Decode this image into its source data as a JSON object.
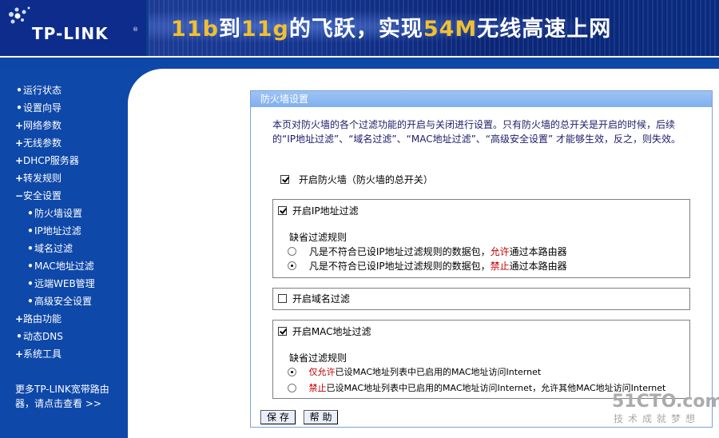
{
  "header": {
    "logo": "TP-LINK",
    "slogan_parts": [
      {
        "text": "11b",
        "hl": true
      },
      {
        "text": "到",
        "hl": false
      },
      {
        "text": "11g",
        "hl": true
      },
      {
        "text": "的飞跃，实现",
        "hl": false
      },
      {
        "text": "54M",
        "hl": true
      },
      {
        "text": "无线高速上网",
        "hl": false
      }
    ]
  },
  "sidebar": {
    "items": [
      {
        "mark": "•",
        "label": "运行状态",
        "level": 0
      },
      {
        "mark": "•",
        "label": "设置向导",
        "level": 0
      },
      {
        "mark": "+",
        "label": "网络参数",
        "level": 0
      },
      {
        "mark": "+",
        "label": "无线参数",
        "level": 0
      },
      {
        "mark": "+",
        "label": "DHCP服务器",
        "level": 0
      },
      {
        "mark": "+",
        "label": "转发规则",
        "level": 0
      },
      {
        "mark": "−",
        "label": "安全设置",
        "level": 0
      },
      {
        "mark": "•",
        "label": "防火墙设置",
        "level": 1
      },
      {
        "mark": "•",
        "label": "IP地址过滤",
        "level": 1
      },
      {
        "mark": "•",
        "label": "域名过滤",
        "level": 1
      },
      {
        "mark": "•",
        "label": "MAC地址过滤",
        "level": 1
      },
      {
        "mark": "•",
        "label": "远端WEB管理",
        "level": 1
      },
      {
        "mark": "•",
        "label": "高级安全设置",
        "level": 1
      },
      {
        "mark": "+",
        "label": "路由功能",
        "level": 0
      },
      {
        "mark": "•",
        "label": "动态DNS",
        "level": 0
      },
      {
        "mark": "+",
        "label": "系统工具",
        "level": 0
      }
    ],
    "more_line1": "更多TP-LINK宽带路由",
    "more_line2": "器，请点击查看 >>"
  },
  "panel": {
    "title": "防火墙设置",
    "description": "本页对防火墙的各个过滤功能的开启与关闭进行设置。只有防火墙的总开关是开启的时候，后续的“IP地址过滤”、“域名过滤”、“MAC地址过滤”、“高级安全设置” 才能够生效，反之，则失效。",
    "master_switch": {
      "label": "开启防火墙（防火墙的总开关）",
      "checked": true
    },
    "ip_filter": {
      "label": "开启IP地址过滤",
      "checked": true,
      "rule_label": "缺省过滤规则",
      "opt1_pre": "凡是不符合已设IP地址过滤规则的数据包，",
      "opt1_red": "允许",
      "opt1_post": "通过本路由器",
      "opt2_pre": "凡是不符合已设IP地址过滤规则的数据包，",
      "opt2_red": "禁止",
      "opt2_post": "通过本路由器",
      "selected": 2
    },
    "domain_filter": {
      "label": "开启域名过滤",
      "checked": false
    },
    "mac_filter": {
      "label": "开启MAC地址过滤",
      "checked": true,
      "rule_label": "缺省过滤规则",
      "opt1_red": "仅允许",
      "opt1_post": "已设MAC地址列表中已启用的MAC地址访问Internet",
      "opt2_red": "禁止",
      "opt2_post": "已设MAC地址列表中已启用的MAC地址访问Internet，允许其他MAC地址访问Internet",
      "selected": 1
    },
    "buttons": {
      "save": "保 存",
      "help": "帮 助"
    }
  },
  "watermark": {
    "big": "51CTO.com",
    "small": "技术成就梦想"
  }
}
